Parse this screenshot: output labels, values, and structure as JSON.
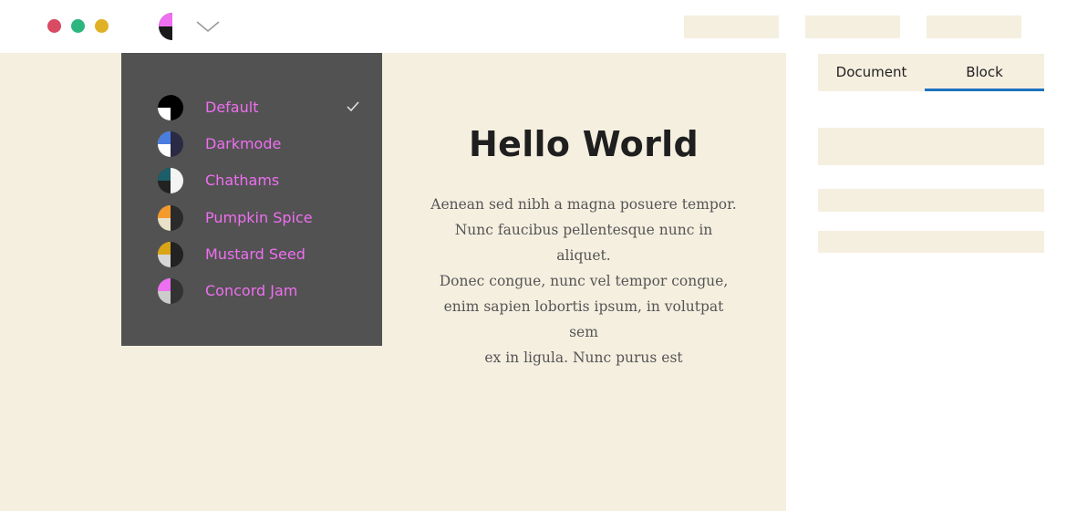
{
  "colors": {
    "cream": "#f5efe0",
    "menu_bg": "#525252",
    "menu_text": "#ee6ff0",
    "accent_blue": "#1e73be",
    "dot_red": "#d94a63",
    "dot_green": "#2db57f",
    "dot_yellow": "#e0b125",
    "check": "#e6e6e6",
    "chevron": "#9a9a9a"
  },
  "toolbar": {
    "window_controls": [
      "close",
      "minimize",
      "maximize"
    ],
    "theme_switcher_icon": "half-moon-swatch-icon",
    "theme_switcher_colors": [
      "#ee6ff0",
      "#1a1a1a",
      "#ffffff"
    ],
    "dropdown_icon": "chevron-down-icon"
  },
  "theme_menu": {
    "selected": "Default",
    "items": [
      {
        "label": "Default",
        "colors": [
          "#000000",
          "#ffffff",
          "#000000"
        ],
        "checked": true
      },
      {
        "label": "Darkmode",
        "colors": [
          "#4a7de0",
          "#ffffff",
          "#2a2a44"
        ],
        "checked": false
      },
      {
        "label": "Chathams",
        "colors": [
          "#1c5f6b",
          "#222222",
          "#f3f3f3"
        ],
        "checked": false
      },
      {
        "label": "Pumpkin Spice",
        "colors": [
          "#f39a2b",
          "#e9e0c8",
          "#2a2a2a"
        ],
        "checked": false
      },
      {
        "label": "Mustard Seed",
        "colors": [
          "#d9a514",
          "#d6d6d6",
          "#222222"
        ],
        "checked": false
      },
      {
        "label": "Concord Jam",
        "colors": [
          "#ee6ff0",
          "#cccccc",
          "#333333"
        ],
        "checked": false
      }
    ]
  },
  "content": {
    "title": "Hello World",
    "paragraph_lines": [
      "Aenean sed nibh a magna posuere tempor.",
      "Nunc faucibus pellentesque nunc in aliquet.",
      "Donec congue, nunc vel tempor congue,",
      "enim sapien lobortis ipsum, in volutpat sem",
      "ex in ligula. Nunc purus est"
    ]
  },
  "sidebar": {
    "tabs": [
      {
        "label": "Document",
        "active": false
      },
      {
        "label": "Block",
        "active": true
      }
    ]
  }
}
